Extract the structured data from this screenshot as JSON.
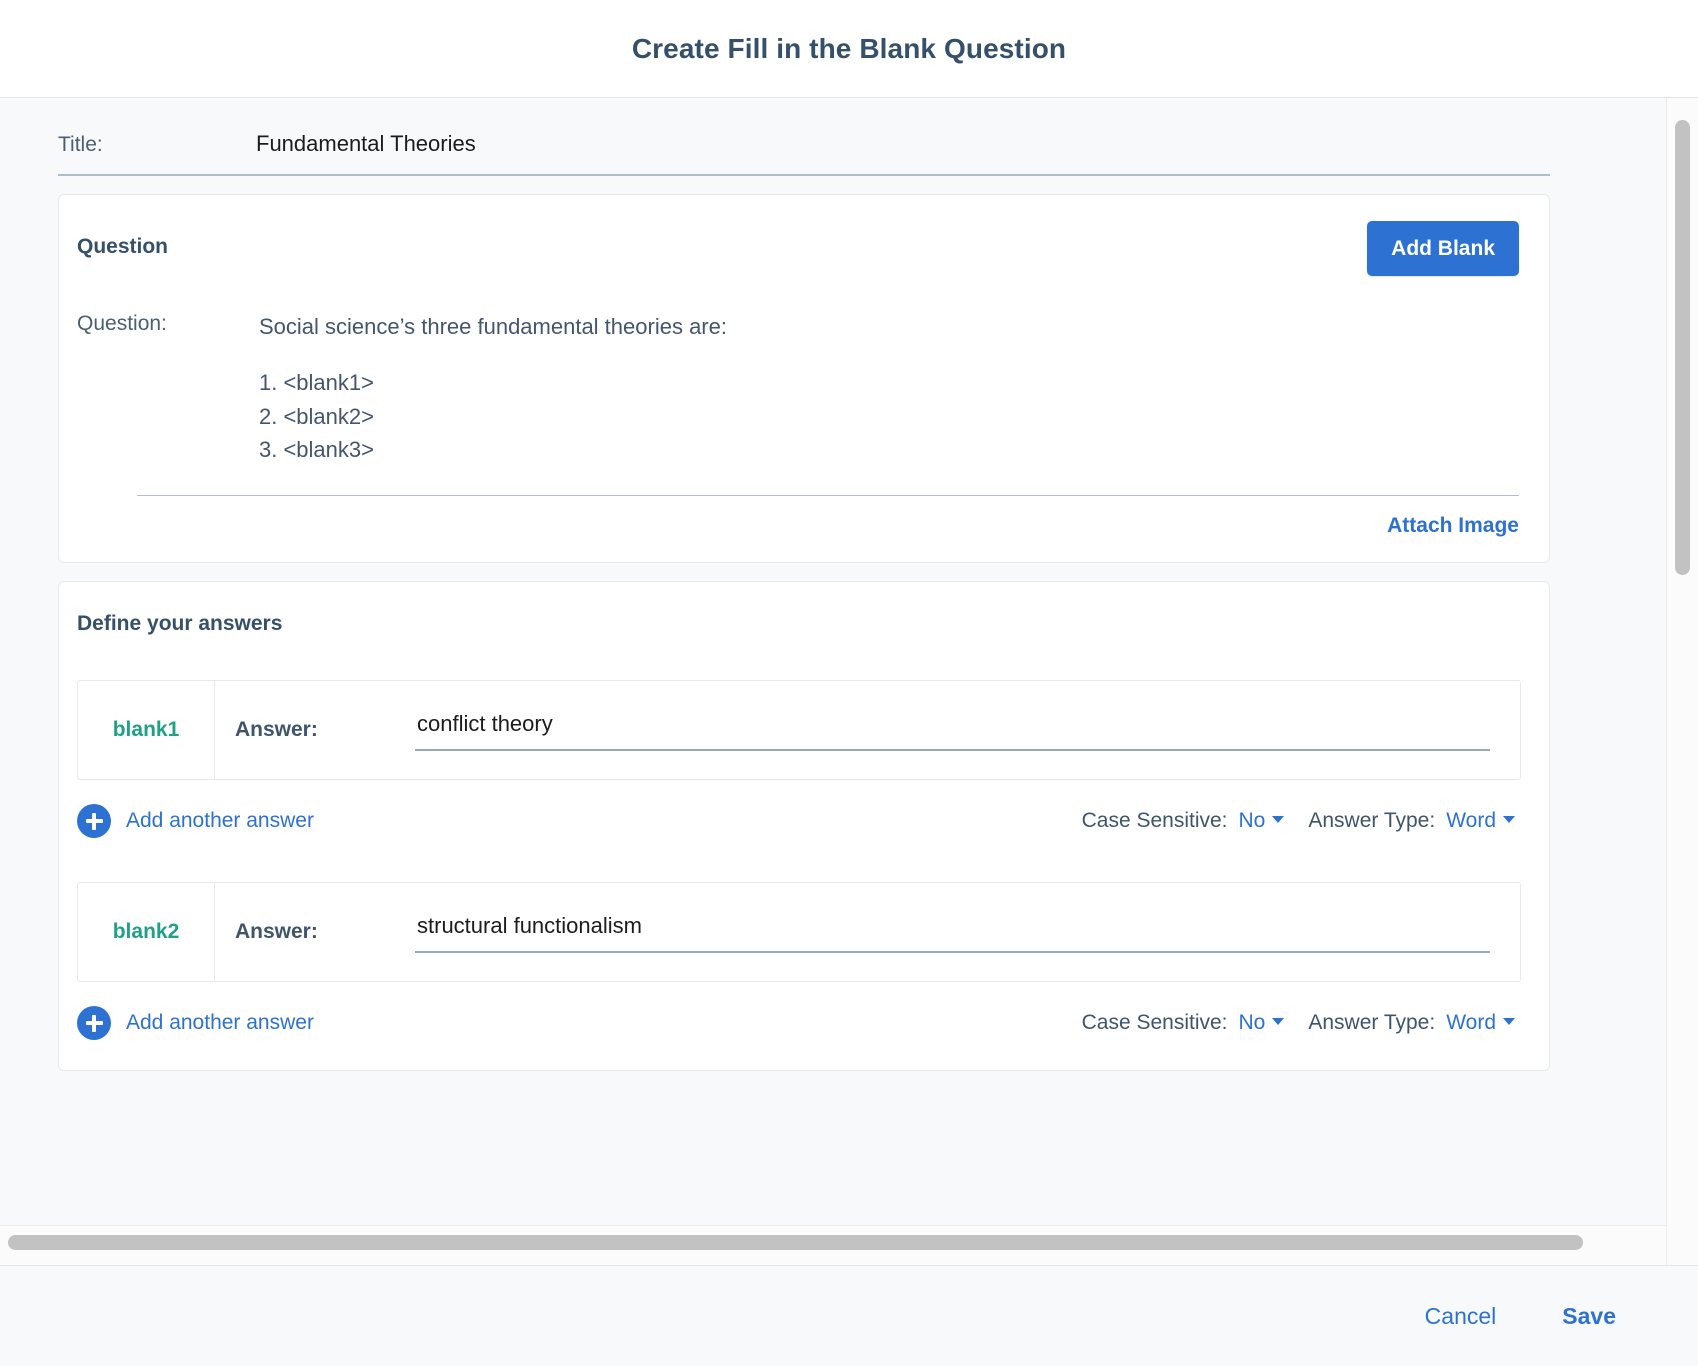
{
  "header": {
    "title": "Create Fill in the Blank Question"
  },
  "title_field": {
    "label": "Title:",
    "value": "Fundamental Theories"
  },
  "question_card": {
    "heading": "Question",
    "add_blank_label": "Add Blank",
    "question_label": "Question:",
    "prompt": "Social science’s three fundamental theories are:",
    "lines": [
      "1. <blank1>",
      "2. <blank2>",
      "3. <blank3>"
    ],
    "attach_image_label": "Attach Image"
  },
  "answers_card": {
    "heading": "Define your answers",
    "blanks": [
      {
        "name": "blank1",
        "answer_label": "Answer:",
        "answer_value": "conflict theory",
        "add_another_label": "Add another answer",
        "case_sensitive_label": "Case Sensitive:",
        "case_sensitive_value": "No",
        "answer_type_label": "Answer Type:",
        "answer_type_value": "Word"
      },
      {
        "name": "blank2",
        "answer_label": "Answer:",
        "answer_value": "structural functionalism",
        "add_another_label": "Add another answer",
        "case_sensitive_label": "Case Sensitive:",
        "case_sensitive_value": "No",
        "answer_type_label": "Answer Type:",
        "answer_type_value": "Word"
      }
    ]
  },
  "footer": {
    "cancel_label": "Cancel",
    "save_label": "Save"
  },
  "colors": {
    "accent_blue": "#2d72d2",
    "heading_slate": "#35506b",
    "blank_teal": "#20a087",
    "body_bg": "#f8f9fa",
    "card_bg": "#ffffff",
    "scrollbar_thumb": "#c2c2c2"
  }
}
